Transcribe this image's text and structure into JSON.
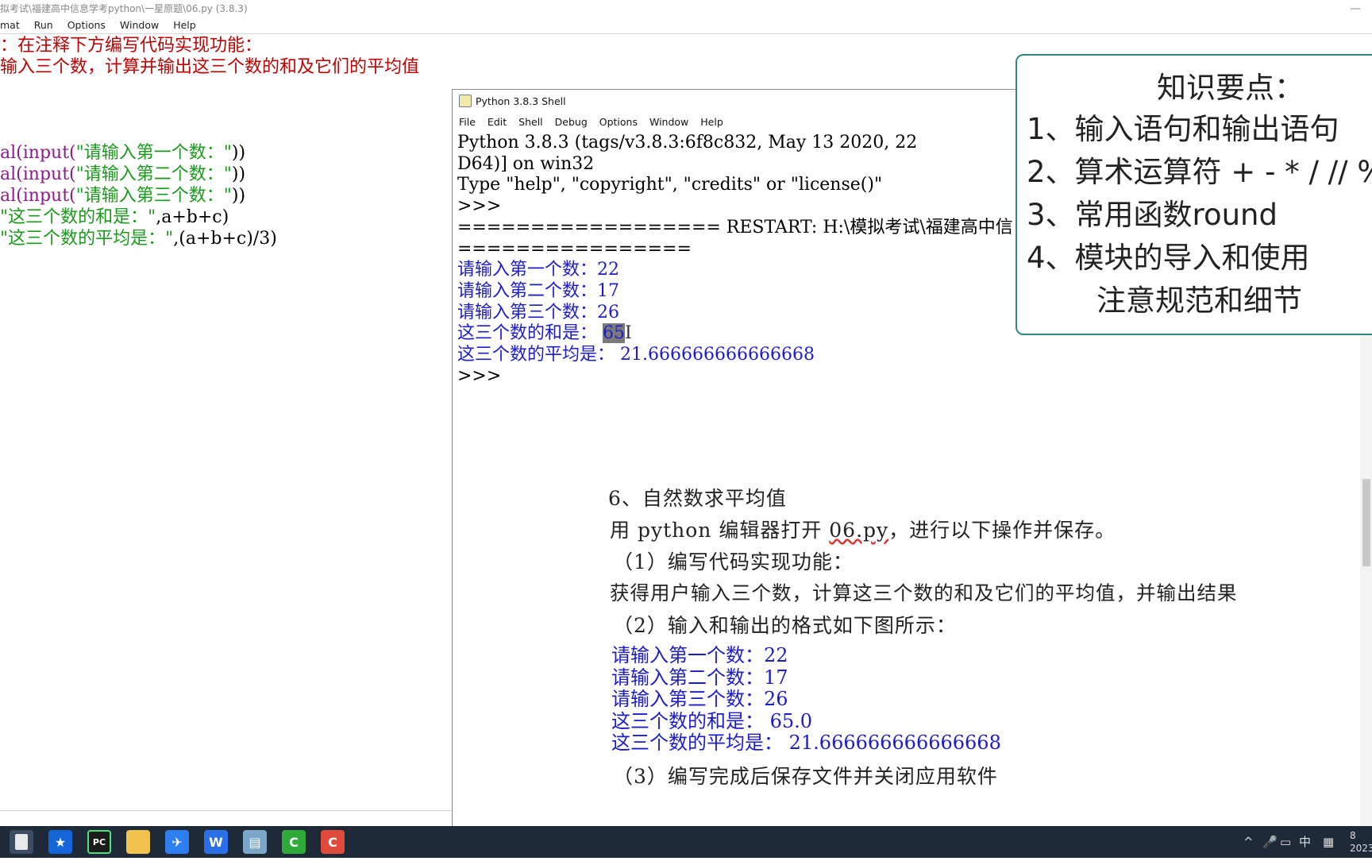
{
  "editor": {
    "title": "拟考试\\福建高中信息学考python\\一星原题\\06.py (3.8.3)",
    "minimize": "—",
    "menu": [
      "mat",
      "Run",
      "Options",
      "Window",
      "Help"
    ],
    "code": {
      "comment1": "：在注释下方编写代码实现功能：",
      "comment2": "输入三个数，计算并输出这三个数的和及它们的平均值",
      "l1_fn": "al(input(",
      "l1_str": "\"请输入第一个数：\"",
      "l1_end": "))",
      "l2_fn": "al(input(",
      "l2_str": "\"请输入第二个数：\"",
      "l2_end": "))",
      "l3_fn": "al(input(",
      "l3_str": "\"请输入第三个数：\"",
      "l3_end": "))",
      "l4_str": "\"这三个数的和是：\"",
      "l4_end": ",a+b+c)",
      "l5_str": "\"这三个数的平均是：\"",
      "l5_end": ",(a+b+c)/3)"
    }
  },
  "shell": {
    "title": "Python 3.8.3 Shell",
    "menu": [
      "File",
      "Edit",
      "Shell",
      "Debug",
      "Options",
      "Window",
      "Help"
    ],
    "lines": {
      "banner1": "Python 3.8.3 (tags/v3.8.3:6f8c832, May 13 2020, 22",
      "banner2": "D64)] on win32",
      "banner3": "Type \"help\", \"copyright\", \"credits\" or \"license()\"",
      "prompt1": ">>>",
      "restart1": "================== RESTART: H:\\模拟考试\\福建高中信",
      "restart2": "================",
      "in1": "请输入第一个数：22",
      "in2": "请输入第二个数：17",
      "in3": "请输入第三个数：26",
      "sum_label": "这三个数的和是： ",
      "sum_value": "65",
      "avg": "这三个数的平均是： 21.666666666666668",
      "prompt2": ">>>"
    }
  },
  "knowledge": {
    "title": "知识要点：",
    "items": [
      "1、输入语句和输出语句",
      "2、算术运算符 + - * / // %",
      "3、常用函数round",
      "4、模块的导入和使用"
    ],
    "note": "注意规范和细节"
  },
  "question": {
    "heading": "6、自然数求平均值",
    "line1_pre": "用 python 编辑器打开 ",
    "line1_file": "06.py",
    "line1_post": "，进行以下操作并保存。",
    "step1": "（1）编写代码实现功能：",
    "desc": "获得用户输入三个数，计算这三个数的和及它们的平均值，并输出结果",
    "step2": "（2）输入和输出的格式如下图所示：",
    "ex1": "请输入第一个数：22",
    "ex2": "请输入第二个数：17",
    "ex3": "请输入第三个数：26",
    "ex4": "这三个数的和是： 65.0",
    "ex5": "这三个数的平均是： 21.666666666666668",
    "step3": "（3）编写完成后保存文件并关闭应用软件"
  },
  "taskbar": {
    "apps": [
      "file-explorer",
      "star-app",
      "pycharm",
      "folder",
      "feishu",
      "wps-writer",
      "notepad",
      "green-app",
      "red-app"
    ],
    "tray_ime": "中",
    "clock_time": "8",
    "clock_date": "2023"
  }
}
